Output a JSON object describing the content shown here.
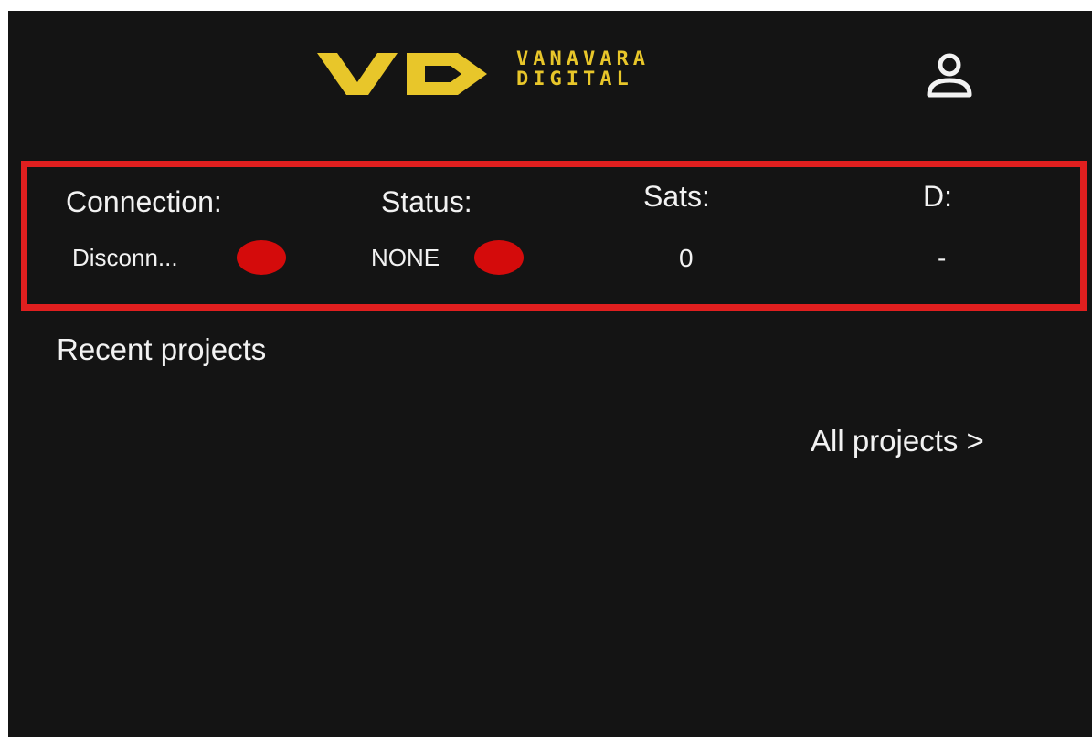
{
  "header": {
    "logo_text_line1": "VANAVARA",
    "logo_text_line2": "DIGITAL",
    "brand_color": "#e8c62a",
    "profile_icon": "user-icon"
  },
  "status_panel": {
    "border_color": "#e01f1f",
    "connection": {
      "label": "Connection:",
      "value": "Disconn...",
      "indicator_color": "#d40b0b"
    },
    "status": {
      "label": "Status:",
      "value": "NONE",
      "indicator_color": "#d40b0b"
    },
    "sats": {
      "label": "Sats:",
      "value": "0"
    },
    "d": {
      "label": "D:",
      "value": "-"
    }
  },
  "main": {
    "recent_title": "Recent projects",
    "all_projects_link": "All projects >"
  },
  "colors": {
    "background": "#141414",
    "text": "#f2f2f2"
  }
}
